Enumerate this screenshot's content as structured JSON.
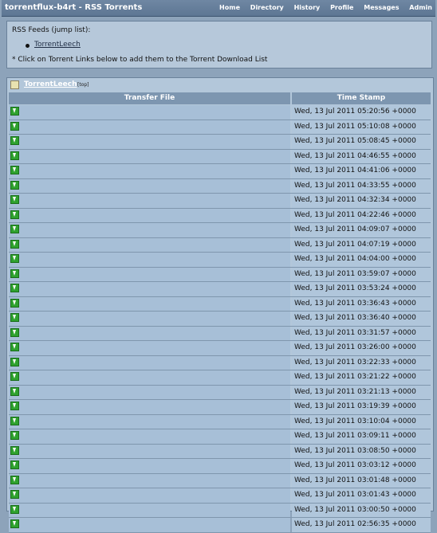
{
  "app": {
    "title": "torrentflux-b4rt - RSS Torrents"
  },
  "nav": {
    "items": [
      "Home",
      "Directory",
      "History",
      "Profile",
      "Messages",
      "Admin"
    ]
  },
  "rss": {
    "heading": "RSS Feeds (jump list):",
    "feeds": [
      "TorrentLeech"
    ],
    "note": "* Click on Torrent Links below to add them to the Torrent Download List"
  },
  "feed": {
    "name": "TorrentLeech",
    "top_link": "[top]",
    "columns": {
      "file": "Transfer File",
      "timestamp": "Time Stamp"
    },
    "rows": [
      "Wed, 13 Jul 2011 05:20:56 +0000",
      "Wed, 13 Jul 2011 05:10:08 +0000",
      "Wed, 13 Jul 2011 05:08:45 +0000",
      "Wed, 13 Jul 2011 04:46:55 +0000",
      "Wed, 13 Jul 2011 04:41:06 +0000",
      "Wed, 13 Jul 2011 04:33:55 +0000",
      "Wed, 13 Jul 2011 04:32:34 +0000",
      "Wed, 13 Jul 2011 04:22:46 +0000",
      "Wed, 13 Jul 2011 04:09:07 +0000",
      "Wed, 13 Jul 2011 04:07:19 +0000",
      "Wed, 13 Jul 2011 04:04:00 +0000",
      "Wed, 13 Jul 2011 03:59:07 +0000",
      "Wed, 13 Jul 2011 03:53:24 +0000",
      "Wed, 13 Jul 2011 03:36:43 +0000",
      "Wed, 13 Jul 2011 03:36:40 +0000",
      "Wed, 13 Jul 2011 03:31:57 +0000",
      "Wed, 13 Jul 2011 03:26:00 +0000",
      "Wed, 13 Jul 2011 03:22:33 +0000",
      "Wed, 13 Jul 2011 03:21:22 +0000",
      "Wed, 13 Jul 2011 03:21:13 +0000",
      "Wed, 13 Jul 2011 03:19:39 +0000",
      "Wed, 13 Jul 2011 03:10:04 +0000",
      "Wed, 13 Jul 2011 03:09:11 +0000",
      "Wed, 13 Jul 2011 03:08:50 +0000",
      "Wed, 13 Jul 2011 03:03:12 +0000",
      "Wed, 13 Jul 2011 03:01:48 +0000",
      "Wed, 13 Jul 2011 03:01:43 +0000",
      "Wed, 13 Jul 2011 03:00:50 +0000",
      "Wed, 13 Jul 2011 02:56:35 +0000"
    ]
  }
}
